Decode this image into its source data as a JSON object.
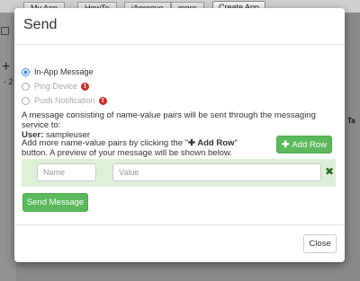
{
  "background": {
    "tabs": [
      "My App",
      "HowTo",
      "iApprove",
      "more"
    ],
    "create_app_label": "Create App",
    "side_plus": "+",
    "side_minus": "- 2",
    "table_header_fragment": "Ta"
  },
  "modal": {
    "title": "Send",
    "options": [
      {
        "label": "In-App Message",
        "checked": true,
        "disabled": false
      },
      {
        "label": "Ping Device",
        "checked": false,
        "disabled": true,
        "info_icon": "info-icon"
      },
      {
        "label": "Push Notification",
        "checked": false,
        "disabled": true,
        "info_icon": "info-icon"
      }
    ],
    "description_text": "A message consisting of name-value pairs will be sent through the messaging service to:",
    "user_label": "User:",
    "user_value": "sampleuser",
    "help_prefix": "Add more name-value pairs by clicking the \"",
    "help_button_ref": "✚ Add Row",
    "help_suffix": "\" button. A preview of your message will be shown below.",
    "add_row_label": "Add Row",
    "add_row_icon": "plus-icon",
    "pair": {
      "name_placeholder": "Name",
      "value_placeholder": "Value",
      "name_value": "",
      "value_value": ""
    },
    "remove_icon": "close-icon",
    "send_label": "Send Message",
    "close_label": "Close"
  },
  "colors": {
    "primary_radio": "#3a87d6",
    "success": "#5cb85c",
    "row_bg": "#dff0d8",
    "info": "#c9302c"
  }
}
